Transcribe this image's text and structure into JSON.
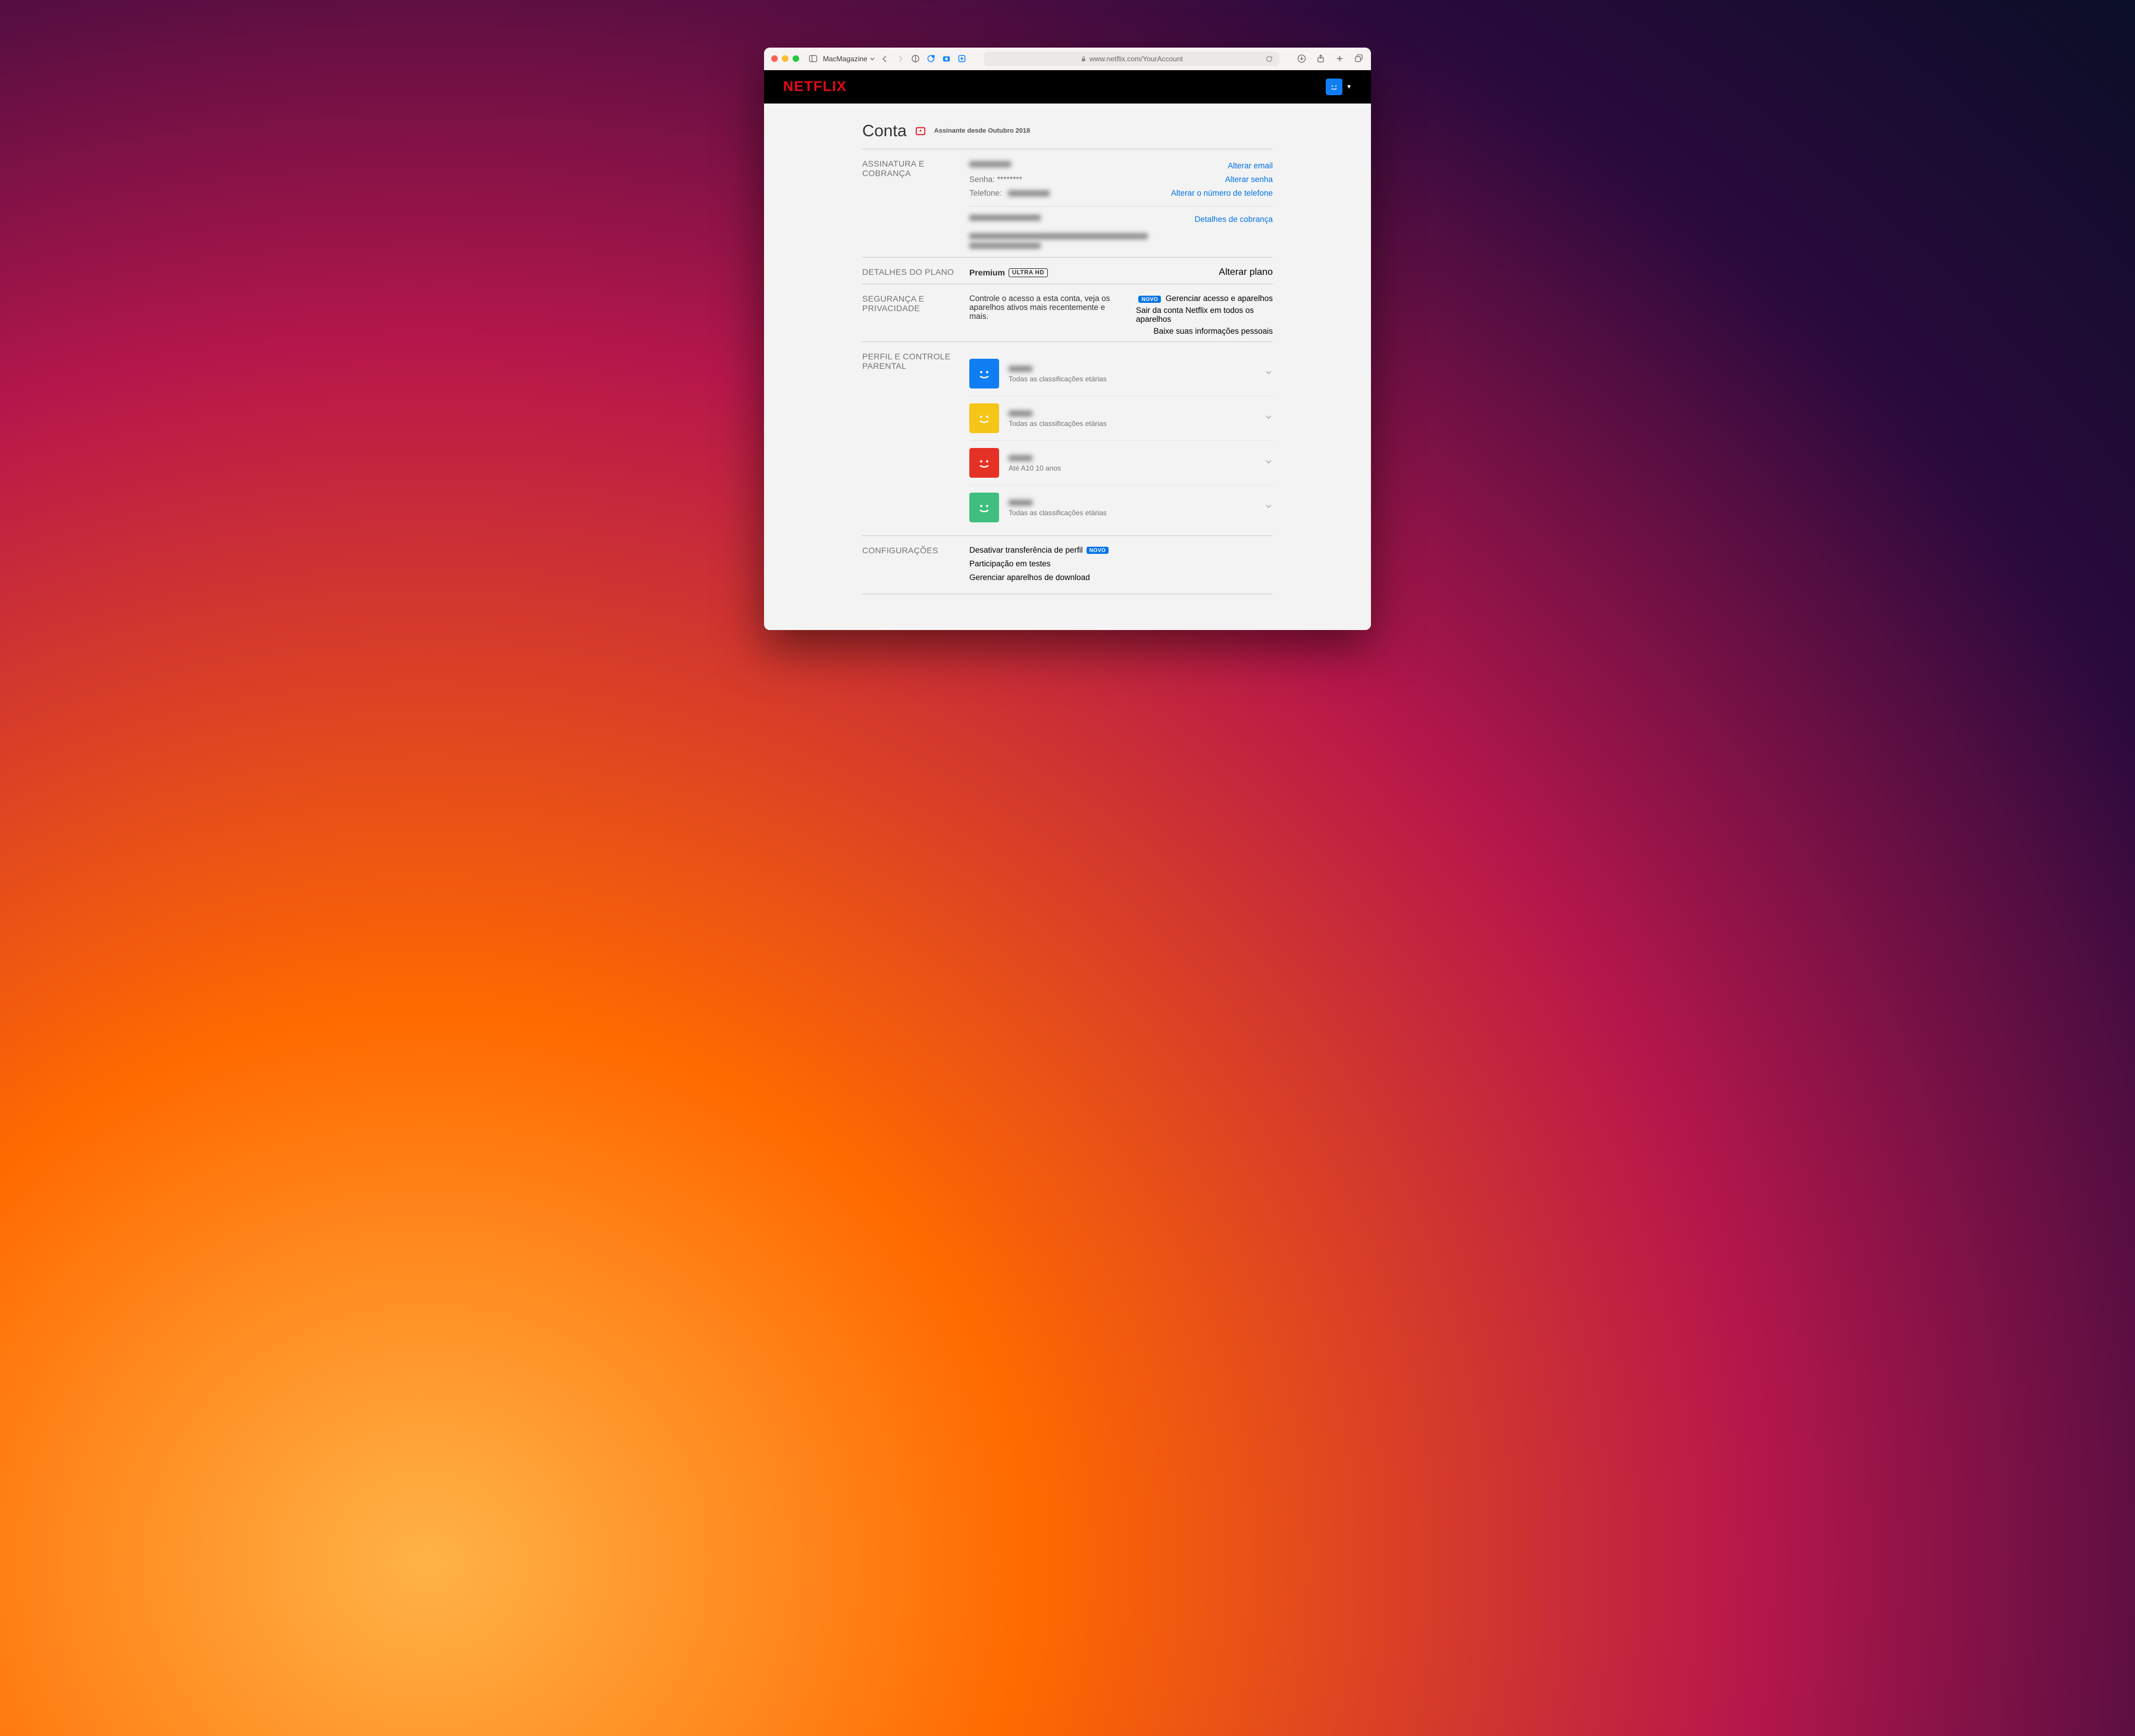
{
  "chrome": {
    "tabGroupLabel": "MacMagazine",
    "url": "www.netflix.com/YourAccount"
  },
  "header": {
    "logo": "NETFLIX"
  },
  "page": {
    "title": "Conta",
    "memberSince": "Assinante desde Outubro 2018"
  },
  "membership": {
    "title": "ASSINATURA E COBRANÇA",
    "passwordLabel": "Senha:",
    "passwordValue": "********",
    "phoneLabel": "Telefone:",
    "links": {
      "changeEmail": "Alterar email",
      "changePassword": "Alterar senha",
      "changePhone": "Alterar o número de telefone",
      "billingDetails": "Detalhes de cobrança"
    }
  },
  "plan": {
    "title": "DETALHES DO PLANO",
    "name": "Premium",
    "badge": "ULTRA HD",
    "link": "Alterar plano"
  },
  "security": {
    "title": "SEGURANÇA E PRIVACIDADE",
    "description": "Controle o acesso a esta conta, veja os aparelhos ativos mais recentemente e mais.",
    "novoBadge": "NOVO",
    "links": {
      "manageAccess": "Gerenciar acesso e aparelhos",
      "signOutAll": "Sair da conta Netflix em todos os aparelhos",
      "downloadInfo": "Baixe suas informações pessoais"
    }
  },
  "profiles": {
    "title": "PERFIL E CONTROLE PARENTAL",
    "items": [
      {
        "color": "#0f7ef3",
        "rating": "Todas as classificações etárias"
      },
      {
        "color": "#f5c518",
        "rating": "Todas as classificações etárias"
      },
      {
        "color": "#e63226",
        "rating": "Até A10  10 anos"
      },
      {
        "color": "#3fbf7f",
        "rating": "Todas as classificações etárias"
      }
    ]
  },
  "settings": {
    "title": "CONFIGURAÇÕES",
    "novoBadge": "NOVO",
    "links": {
      "disableTransfer": "Desativar transferência de perfil",
      "testParticipation": "Participação em testes",
      "manageDownloads": "Gerenciar aparelhos de download"
    }
  }
}
